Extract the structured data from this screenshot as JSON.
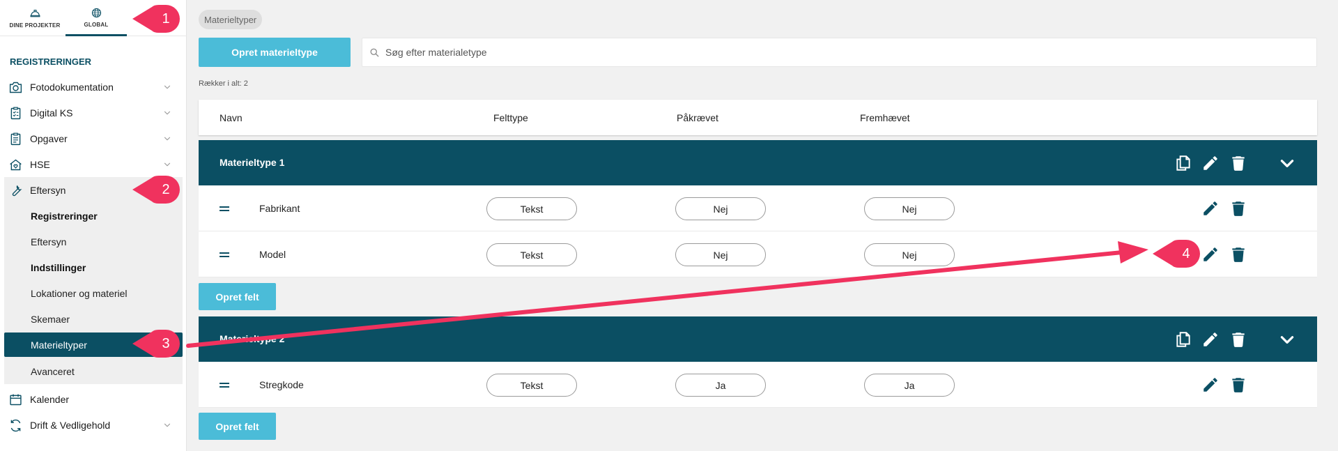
{
  "sidebar": {
    "top_tabs": [
      {
        "label": "DINE PROJEKTER",
        "icon": "hard-hat-icon"
      },
      {
        "label": "GLOBAL",
        "icon": "globe-icon"
      }
    ],
    "section_title": "REGISTRERINGER",
    "nav": [
      {
        "label": "Fotodokumentation",
        "icon": "camera-icon"
      },
      {
        "label": "Digital KS",
        "icon": "clipboard-check-icon"
      },
      {
        "label": "Opgaver",
        "icon": "clipboard-list-icon"
      },
      {
        "label": "HSE",
        "icon": "house-heart-icon"
      },
      {
        "label": "Eftersyn",
        "icon": "wrench-icon"
      }
    ],
    "sub_items": [
      {
        "label": "Registreringer"
      },
      {
        "label": "Eftersyn"
      },
      {
        "label": "Indstillinger"
      },
      {
        "label": "Lokationer og materiel"
      },
      {
        "label": "Skemaer"
      },
      {
        "label": "Materieltyper"
      },
      {
        "label": "Avanceret"
      }
    ],
    "nav_bottom": [
      {
        "label": "Kalender",
        "icon": "calendar-icon"
      },
      {
        "label": "Drift & Vedligehold",
        "icon": "sync-icon"
      }
    ]
  },
  "main": {
    "breadcrumb": "Materieltyper",
    "create_button": "Opret materieltype",
    "search_placeholder": "Søg efter materialetype",
    "row_count": "Rækker i alt: 2",
    "columns": [
      "Navn",
      "Felttype",
      "Påkrævet",
      "Fremhævet"
    ],
    "groups": [
      {
        "name": "Materieltype 1",
        "fields": [
          {
            "name": "Fabrikant",
            "type": "Tekst",
            "required": "Nej",
            "highlighted": "Nej"
          },
          {
            "name": "Model",
            "type": "Tekst",
            "required": "Nej",
            "highlighted": "Nej"
          }
        ],
        "add_field": "Opret felt"
      },
      {
        "name": "Materieltype 2",
        "fields": [
          {
            "name": "Stregkode",
            "type": "Tekst",
            "required": "Ja",
            "highlighted": "Ja"
          }
        ],
        "add_field": "Opret felt"
      }
    ]
  },
  "annotations": [
    "1",
    "2",
    "3",
    "4"
  ],
  "colors": {
    "accent": "#4bbcd8",
    "primary": "#0b4f63",
    "annotation": "#f0325e"
  }
}
